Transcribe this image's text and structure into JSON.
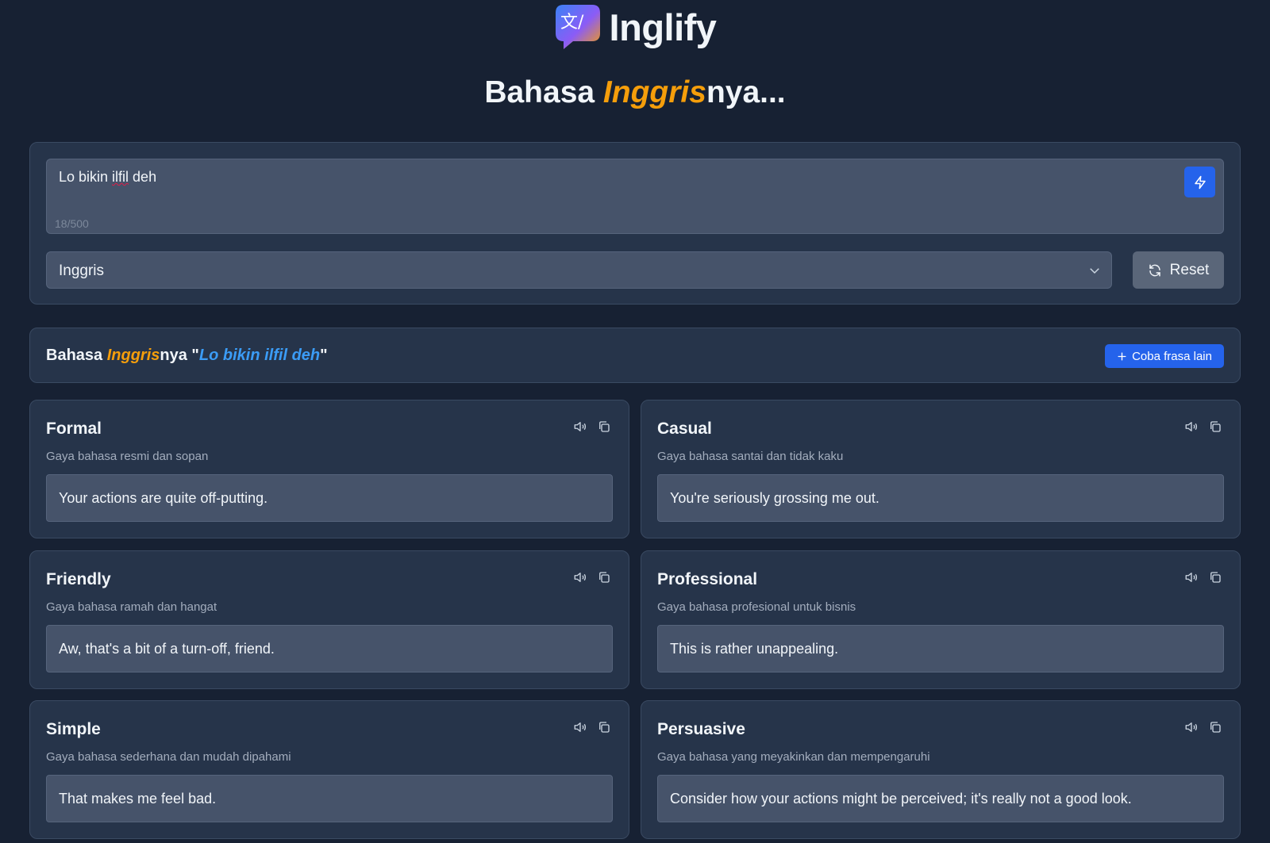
{
  "brand": {
    "name": "Inglify",
    "logo_glyph": "文/"
  },
  "headline": {
    "prefix": "Bahasa ",
    "highlight": "Inggris",
    "suffix": "nya..."
  },
  "input": {
    "text_plain": "Lo bikin ",
    "text_spell": "ilfil",
    "text_end": " deh",
    "char_count": "18/500",
    "submit_icon": "bolt-icon"
  },
  "language_select": {
    "selected": "Inggris"
  },
  "reset_button": {
    "label": "Reset"
  },
  "result": {
    "prefix": "Bahasa ",
    "highlight": "Inggris",
    "middle": "nya \"",
    "phrase": "Lo bikin ilfil deh",
    "suffix": "\"",
    "try_label": "Coba frasa lain"
  },
  "cards": [
    {
      "title": "Formal",
      "description": "Gaya bahasa resmi dan sopan",
      "output": "Your actions are quite off-putting."
    },
    {
      "title": "Casual",
      "description": "Gaya bahasa santai dan tidak kaku",
      "output": "You're seriously grossing me out."
    },
    {
      "title": "Friendly",
      "description": "Gaya bahasa ramah dan hangat",
      "output": "Aw, that's a bit of a turn-off, friend."
    },
    {
      "title": "Professional",
      "description": "Gaya bahasa profesional untuk bisnis",
      "output": "This is rather unappealing."
    },
    {
      "title": "Simple",
      "description": "Gaya bahasa sederhana dan mudah dipahami",
      "output": "That makes me feel bad."
    },
    {
      "title": "Persuasive",
      "description": "Gaya bahasa yang meyakinkan dan mempengaruhi",
      "output": "Consider how your actions might be perceived; it's really not a good look."
    }
  ],
  "colors": {
    "background": "#172133",
    "panel": "#26344a",
    "field": "#46536a",
    "accent_orange": "#f59e0b",
    "accent_blue": "#3b9cf6",
    "primary_button": "#2563eb"
  }
}
